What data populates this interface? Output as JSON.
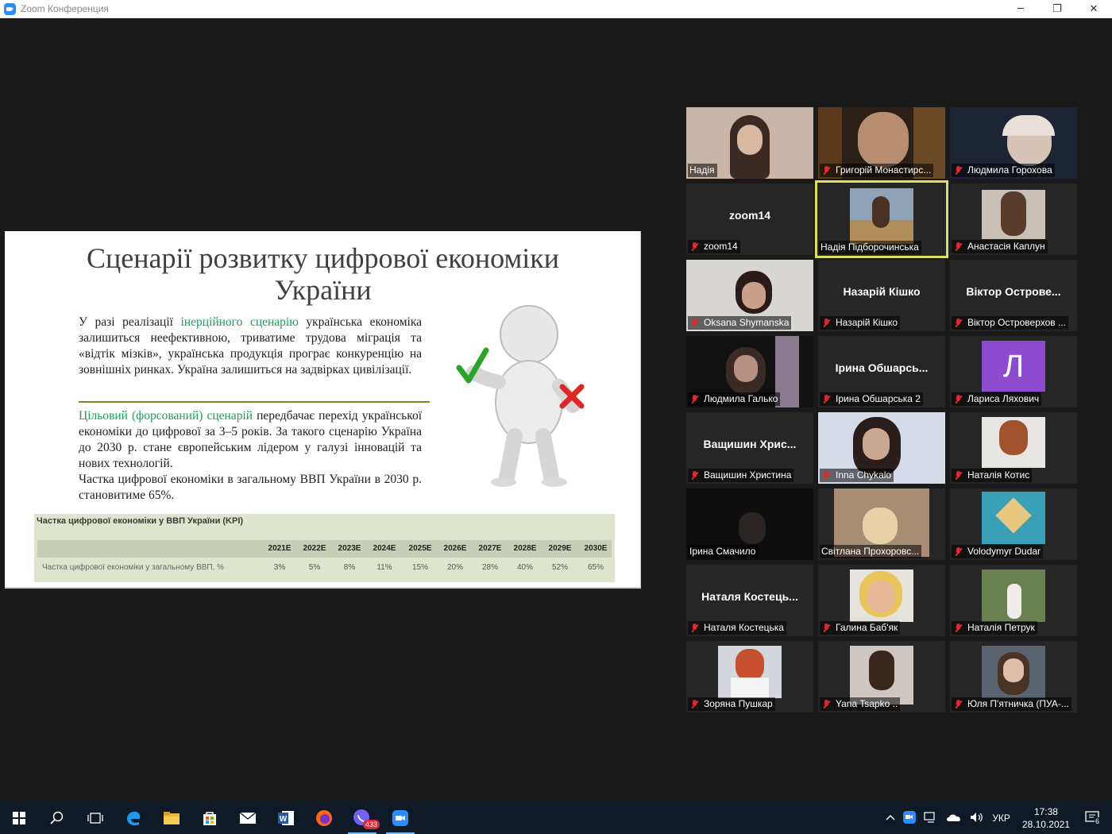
{
  "window": {
    "title": "Zoom Конференция",
    "minimize": "─",
    "restore": "❐",
    "close": "✕"
  },
  "slide": {
    "title_line1": "Сценарії розвитку цифрової економіки",
    "title_line2": "України",
    "p1_a": "У разі реалізації ",
    "p1_green": "інерційного сценарію",
    "p1_b": " українська економіка залишиться неефективною, триватиме трудова міграція та «відтік мізків», українська продукція програє конкуренцію на зовнішніх ринках. Україна залишиться на задвірках цивілізації.",
    "p2_green": "Цільовий (форсований) сценарій",
    "p2_b": " передбачає перехід української економіки до цифрової за 3–5 років. За такого сценарію Україна до 2030 р. стане європейським лідером у галузі інновацій та нових технологій.",
    "p3": "Частка цифрової економіки в загальному ВВП України в 2030 р. становитиме 65%.",
    "kpi": {
      "title": "Частка цифрової економіки у ВВП України (KPI)",
      "row_label": "Частка цифрової економіки у загальному ВВП, %",
      "years": [
        "2021E",
        "2022E",
        "2023E",
        "2024E",
        "2025E",
        "2026E",
        "2027E",
        "2028E",
        "2029E",
        "2030E"
      ],
      "values": [
        "3%",
        "5%",
        "8%",
        "11%",
        "15%",
        "20%",
        "28%",
        "40%",
        "52%",
        "65%"
      ]
    }
  },
  "participants": [
    {
      "name": "Надія",
      "muted": false,
      "video": true
    },
    {
      "name": "Григорій Монастирс...",
      "muted": true,
      "video": true
    },
    {
      "name": "Людмила Горохова",
      "muted": true,
      "video": true
    },
    {
      "name": "zoom14",
      "muted": true,
      "video": false,
      "display": "zoom14"
    },
    {
      "name": "Надія Підборочинська",
      "muted": false,
      "video": true,
      "active": true
    },
    {
      "name": "Анастасія Каплун",
      "muted": true,
      "video": true
    },
    {
      "name": "Oksana Shymanska",
      "muted": true,
      "video": true
    },
    {
      "name": "Назарій Кішко",
      "muted": true,
      "video": false,
      "display": "Назарій Кішко"
    },
    {
      "name": "Віктор Островерхов ...",
      "muted": true,
      "video": false,
      "display": "Віктор  Острове..."
    },
    {
      "name": "Людмила Галько",
      "muted": true,
      "video": true
    },
    {
      "name": "Ірина Обшарська 2",
      "muted": true,
      "video": false,
      "display": "Ірина  Обшарсь..."
    },
    {
      "name": "Лариса Ляхович",
      "muted": true,
      "video": false,
      "avatar": "Л"
    },
    {
      "name": "Ващишин Христина",
      "muted": true,
      "video": false,
      "display": "Ващишин  Хрис..."
    },
    {
      "name": "Inna Chykalo",
      "muted": true,
      "video": true
    },
    {
      "name": "Наталія Котис",
      "muted": true,
      "video": true
    },
    {
      "name": "Ірина Смачило",
      "muted": false,
      "video": true
    },
    {
      "name": "Світлана Прохоровс...",
      "muted": false,
      "video": true
    },
    {
      "name": "Volodymyr Dudar",
      "muted": true,
      "video": true
    },
    {
      "name": "Наталя Костецька",
      "muted": true,
      "video": false,
      "display": "Наталя  Костець..."
    },
    {
      "name": "Галина Баб'як",
      "muted": true,
      "video": true
    },
    {
      "name": "Наталія Петрук",
      "muted": true,
      "video": true
    },
    {
      "name": "Зоряна Пушкар",
      "muted": true,
      "video": true
    },
    {
      "name": "Yana Tsapko ..",
      "muted": true,
      "video": true
    },
    {
      "name": "Юля П'ятничка (ПУА-...",
      "muted": true,
      "video": true
    }
  ],
  "taskbar": {
    "viber_badge": "433",
    "language": "УКР",
    "time": "17:38",
    "date": "28.10.2021",
    "notifications": "6"
  }
}
